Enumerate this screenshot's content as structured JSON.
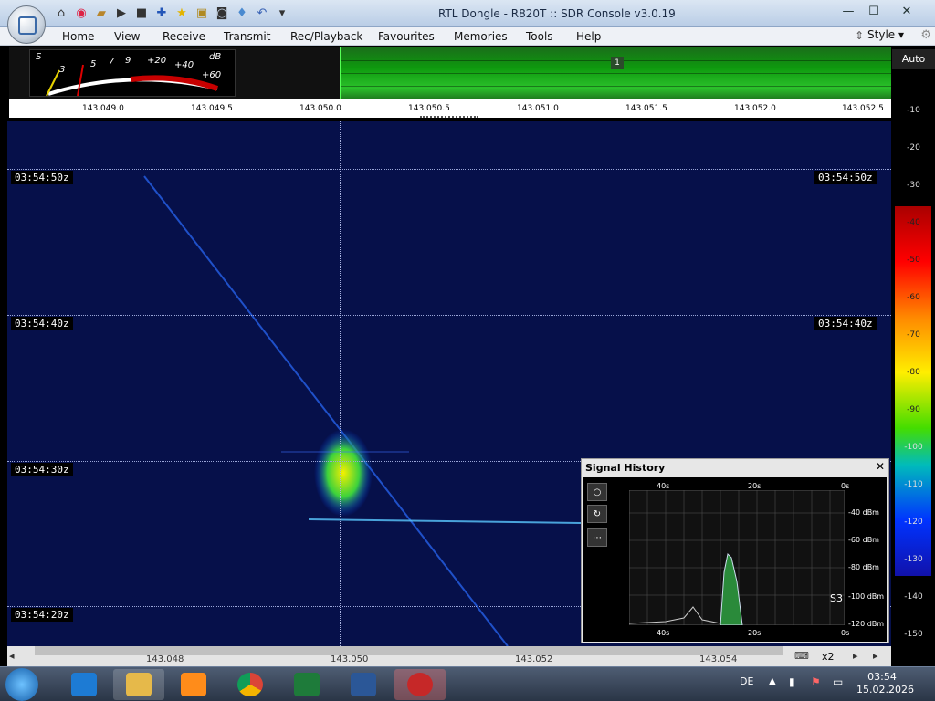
{
  "window": {
    "title": "RTL Dongle - R820T :: SDR Console v3.0.19",
    "minimize": "—",
    "maximize": "☐",
    "close": "✕"
  },
  "menu": [
    "Home",
    "View",
    "Receive",
    "Transmit",
    "Rec/Playback",
    "Favourites",
    "Memories",
    "Tools",
    "Help"
  ],
  "style_label": "Style",
  "smeter": {
    "s_label": "S",
    "db_label": "dB",
    "scale": [
      "3",
      "5",
      "7",
      "9",
      "+20",
      "+40",
      "+60"
    ]
  },
  "vfo_badge": "1",
  "freq_scale": [
    "143.049.0",
    "143.049.5",
    "143.050.0",
    "143.050.5",
    "143.051.0",
    "143.051.5",
    "143.052.0",
    "143.052.5"
  ],
  "db_scale": {
    "auto": "Auto",
    "ticks": [
      "-10",
      "-20",
      "-30",
      "-40",
      "-50",
      "-60",
      "-70",
      "-80",
      "-90",
      "-100",
      "-110",
      "-120",
      "-130",
      "-140",
      "-150"
    ]
  },
  "timestamps": [
    "03:54:50z",
    "03:54:40z",
    "03:54:30z",
    "03:54:20z"
  ],
  "signal_history": {
    "title": "Signal History",
    "close": "✕",
    "top_axis": [
      "40s",
      "20s",
      "0s"
    ],
    "bottom_axis": [
      "40s",
      "20s",
      "0s"
    ],
    "y_axis": [
      "-40 dBm",
      "-60 dBm",
      "-80 dBm",
      "-100 dBm",
      "-120 dBm"
    ],
    "s_reading": "S3",
    "buttons": [
      "○",
      "↻",
      "⋯"
    ]
  },
  "bottom_freqs": [
    "143.048",
    "143.050",
    "143.052",
    "143.054"
  ],
  "zoom": "x2",
  "taskbar": {
    "lang": "DE",
    "time": "03:54",
    "date": "15.02.2026"
  }
}
